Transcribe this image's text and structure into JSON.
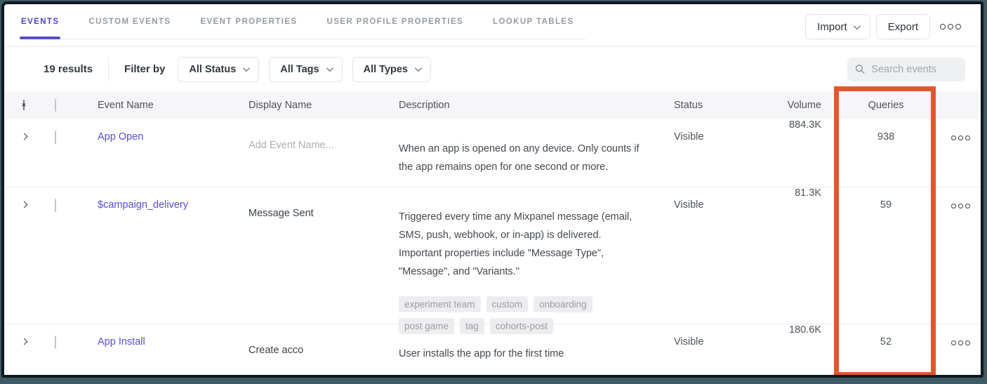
{
  "tabs": [
    {
      "label": "EVENTS",
      "active": true
    },
    {
      "label": "CUSTOM EVENTS",
      "active": false
    },
    {
      "label": "EVENT PROPERTIES",
      "active": false
    },
    {
      "label": "USER PROFILE PROPERTIES",
      "active": false
    },
    {
      "label": "LOOKUP TABLES",
      "active": false
    }
  ],
  "toolbar": {
    "import_label": "Import",
    "export_label": "Export",
    "overflow_icon": "more-options"
  },
  "filters": {
    "results_count": "19 results",
    "filter_by_label": "Filter by",
    "status_dropdown": "All Status",
    "tags_dropdown": "All Tags",
    "types_dropdown": "All Types",
    "search_placeholder": "Search events"
  },
  "table": {
    "columns": {
      "event_name": "Event Name",
      "display_name": "Display Name",
      "description": "Description",
      "status": "Status",
      "volume": "Volume",
      "queries": "Queries"
    },
    "rows": [
      {
        "event_name": "App Open",
        "display_name_placeholder": "Add Event Name...",
        "description": "When an app is opened on any device. Only counts if the app remains open for one second or more.",
        "status": "Visible",
        "volume": "884.3K",
        "queries": "938"
      },
      {
        "event_name": "$campaign_delivery",
        "display_name": "Message Sent",
        "description": "Triggered every time any Mixpanel message (email, SMS, push, webhook, or in-app) is delivered. Important properties include \"Message Type\", \"Message\", and \"Variants.\"",
        "status": "Visible",
        "volume": "81.3K",
        "queries": "59",
        "tags": [
          "experiment team",
          "custom",
          "onboarding",
          "post game",
          "tag",
          "cohorts-post"
        ]
      },
      {
        "event_name": "App Install",
        "display_name": "Create acco",
        "description": "User installs the app for the first time",
        "status": "Visible",
        "volume": "180.6K",
        "queries": "52"
      }
    ]
  },
  "highlight": {
    "color": "#e0572e",
    "column": "Queries"
  }
}
